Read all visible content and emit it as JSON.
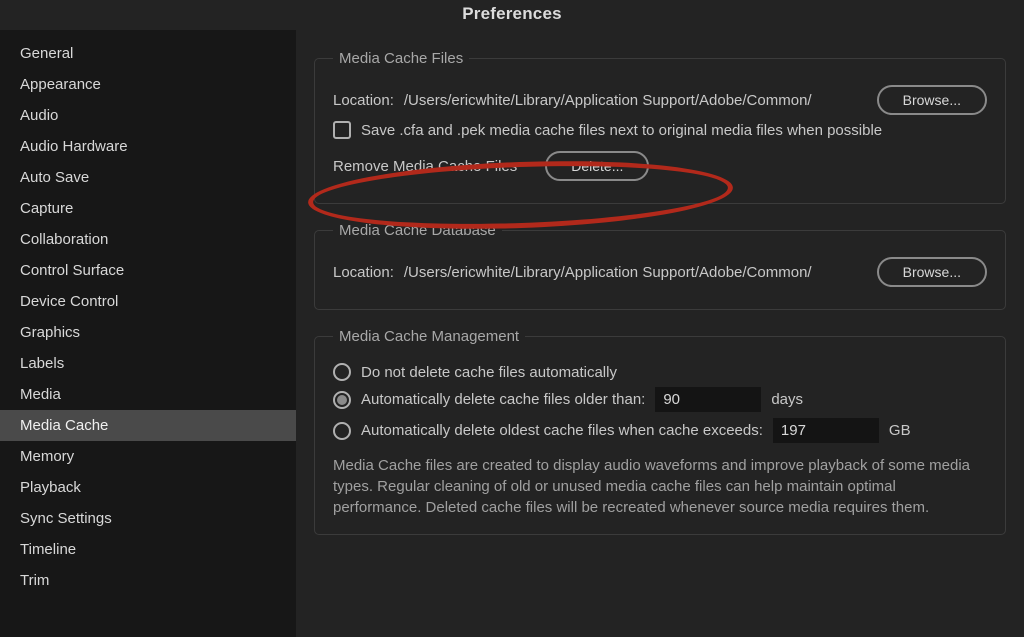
{
  "header": {
    "title": "Preferences"
  },
  "sidebar": {
    "selected_index": 12,
    "items": [
      {
        "label": "General"
      },
      {
        "label": "Appearance"
      },
      {
        "label": "Audio"
      },
      {
        "label": "Audio Hardware"
      },
      {
        "label": "Auto Save"
      },
      {
        "label": "Capture"
      },
      {
        "label": "Collaboration"
      },
      {
        "label": "Control Surface"
      },
      {
        "label": "Device Control"
      },
      {
        "label": "Graphics"
      },
      {
        "label": "Labels"
      },
      {
        "label": "Media"
      },
      {
        "label": "Media Cache"
      },
      {
        "label": "Memory"
      },
      {
        "label": "Playback"
      },
      {
        "label": "Sync Settings"
      },
      {
        "label": "Timeline"
      },
      {
        "label": "Trim"
      }
    ]
  },
  "panels": {
    "cache_files": {
      "legend": "Media Cache Files",
      "location_label": "Location:",
      "location_path": "/Users/ericwhite/Library/Application Support/Adobe/Common/",
      "browse_label": "Browse...",
      "save_next_to_label": "Save .cfa and .pek media cache files next to original media files when possible",
      "remove_label": "Remove Media Cache Files",
      "delete_label": "Delete..."
    },
    "cache_db": {
      "legend": "Media Cache Database",
      "location_label": "Location:",
      "location_path": "/Users/ericwhite/Library/Application Support/Adobe/Common/",
      "browse_label": "Browse..."
    },
    "cache_mgmt": {
      "legend": "Media Cache Management",
      "opt_none": "Do not delete cache files automatically",
      "opt_older": "Automatically delete cache files older than:",
      "older_value": "90",
      "older_unit": "days",
      "opt_exceeds": "Automatically delete oldest cache files when cache exceeds:",
      "exceeds_value": "197",
      "exceeds_unit": "GB",
      "info": "Media Cache files are created to display audio waveforms and improve playback of some media types.  Regular cleaning of old or unused media cache files can help maintain optimal performance. Deleted cache files will be recreated whenever source media requires them."
    }
  }
}
